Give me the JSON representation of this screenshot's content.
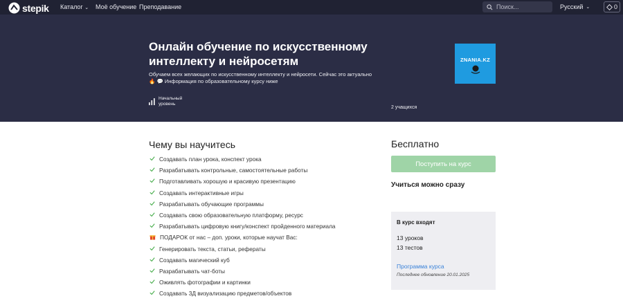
{
  "nav": {
    "logo_text": "stepik",
    "catalog": "Каталог",
    "my_learning": "Моё обучение",
    "teaching": "Преподавание",
    "search_placeholder": "Поиск...",
    "language": "Русский",
    "score": "0"
  },
  "hero": {
    "title": "Онлайн обучение по искусственному интеллекту и нейросетям",
    "description_line1": "Обучаем всех желающих по искусственному интеллекту и нейросети. Сейчас это актуально",
    "description_line2": "Информация по образовательному курсу ниже",
    "level": "Начальный уровень",
    "students": "2 учащихся",
    "cover_text": "ZNANIA.KZ",
    "background_color": "#2b2d45"
  },
  "learn": {
    "title": "Чему вы научитесь",
    "items": [
      {
        "icon": "check-icon",
        "text": "Создавать план урока, конспект урока"
      },
      {
        "icon": "check-icon",
        "text": "Разрабатывать контрольные, самостоятельные работы"
      },
      {
        "icon": "check-icon",
        "text": "Подготавливать хорошую и красивую презентацию"
      },
      {
        "icon": "check-icon",
        "text": "Создавать интерактивные игры"
      },
      {
        "icon": "check-icon",
        "text": "Разрабатывать обучающие программы"
      },
      {
        "icon": "check-icon",
        "text": "Создавать свою образовательную платформу, ресурс"
      },
      {
        "icon": "check-icon",
        "text": "Разрабатывать цифровую книгу/конспект пройденного материала"
      },
      {
        "icon": "gift-icon",
        "text": "ПОДАРОК от нас – доп. уроки, которые научат Вас:"
      },
      {
        "icon": "check-icon",
        "text": "Генерировать текста, статьи, рефераты"
      },
      {
        "icon": "check-icon",
        "text": "Создавать магический куб"
      },
      {
        "icon": "check-icon",
        "text": "Разрабатывать чат-боты"
      },
      {
        "icon": "check-icon",
        "text": "Оживлять фотографии и картинки"
      },
      {
        "icon": "check-icon",
        "text": "Создавать 3Д визуализацию предметов/объектов"
      }
    ]
  },
  "sidebar": {
    "price": "Бесплатно",
    "enroll_button": "Поступить на курс",
    "start_note": "Учиться можно сразу",
    "includes_title": "В курс входят",
    "lessons": "13 уроков",
    "tests": "13 тестов",
    "program_link": "Программа курса",
    "last_update": "Последнее обновление 20.01.2025",
    "accent_color": "#9fd4a7",
    "link_color": "#3a82d8"
  }
}
